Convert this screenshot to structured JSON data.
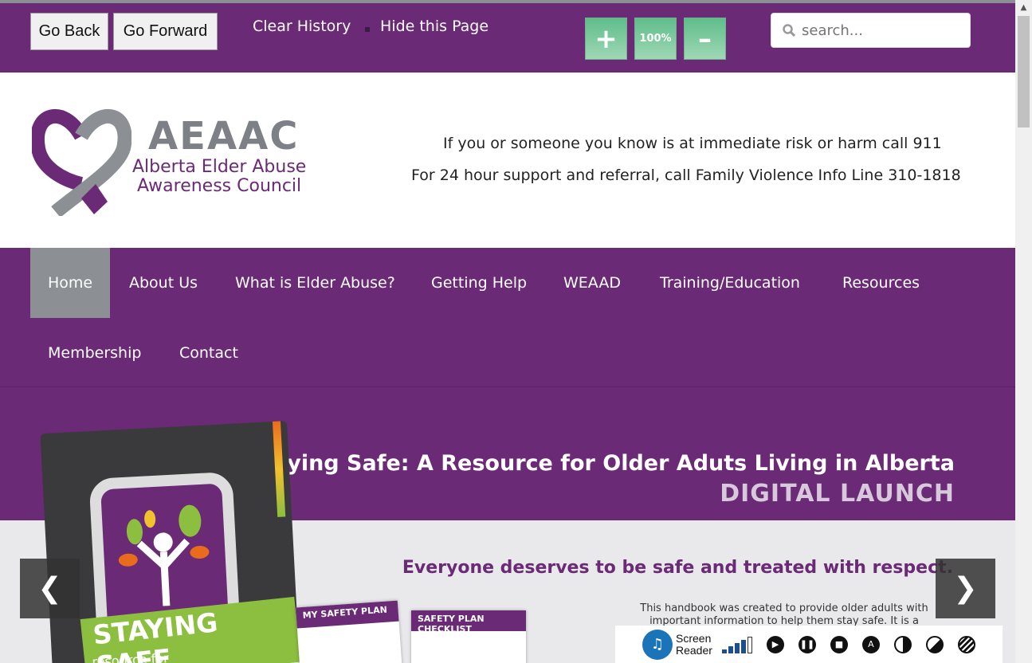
{
  "toolbar": {
    "back_label": "Go Back",
    "forward_label": "Go Forward",
    "clear_history": "Clear History",
    "hide_page": "Hide this Page",
    "zoom_in": "+",
    "zoom_reset": "100%",
    "zoom_out": "–",
    "search_placeholder": "search..."
  },
  "header": {
    "logo_title": "AEAAC",
    "logo_sub1": "Alberta Elder Abuse",
    "logo_sub2": "Awareness Council",
    "help_line1": "If you or someone you know is at immediate risk or harm call 911",
    "help_line2": "For 24 hour support and referral, call Family Violence Info Line 310-1818"
  },
  "nav": {
    "items": [
      {
        "label": "Home"
      },
      {
        "label": "About Us"
      },
      {
        "label": "What is Elder Abuse?"
      },
      {
        "label": "Getting Help"
      },
      {
        "label": "WEAAD"
      },
      {
        "label": "Training/Education"
      },
      {
        "label": "Resources"
      },
      {
        "label": "Membership"
      },
      {
        "label": "Contact"
      }
    ]
  },
  "slide": {
    "title": "Staying Safe: A Resource for Older Aduts Living in Alberta",
    "subtitle": "DIGITAL LAUNCH",
    "tagline": "Everyone deserves to be safe and treated with respect.",
    "body": "This handbook was created to provide older adults with important information to help them stay safe. It is a comprehensive guide that ca",
    "book_banner": "STAYING SAFE",
    "book_sub": "resource for",
    "sheet1_label": "MY SAFETY PLAN",
    "sheet2_label": "SAFETY PLAN CHECKLIST",
    "prev": "❮",
    "next": "❯"
  },
  "reader": {
    "label_line1": "Screen",
    "label_line2": "Reader"
  },
  "colors": {
    "brand_purple": "#6b2a76",
    "nav_active": "#8c8f93",
    "zoom_green": "#5fbd8a"
  }
}
